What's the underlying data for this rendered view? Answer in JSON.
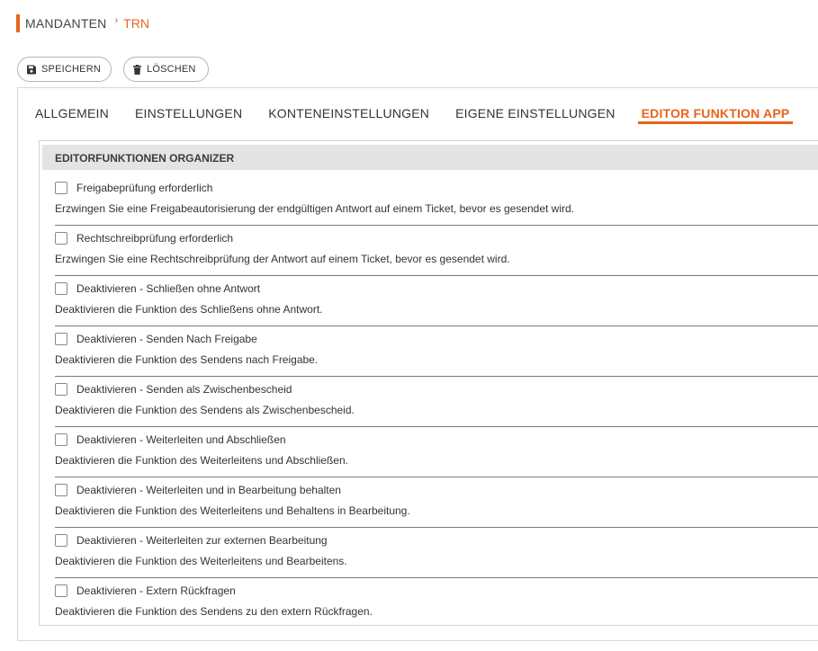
{
  "breadcrumb": {
    "root": "MANDANTEN",
    "separator": "›",
    "current": "TRN"
  },
  "toolbar": {
    "save_label": "SPEICHERN",
    "delete_label": "LÖSCHEN"
  },
  "tabs": [
    {
      "label": "ALLGEMEIN",
      "active": false
    },
    {
      "label": "EINSTELLUNGEN",
      "active": false
    },
    {
      "label": "KONTENEINSTELLUNGEN",
      "active": false
    },
    {
      "label": "EIGENE EINSTELLUNGEN",
      "active": false
    },
    {
      "label": "EDITOR FUNKTION APP",
      "active": true
    }
  ],
  "panel": {
    "title": "EDITORFUNKTIONEN ORGANIZER",
    "options": [
      {
        "label": "Freigabeprüfung erforderlich",
        "checked": false,
        "description": "Erzwingen Sie eine Freigabeautorisierung der endgültigen Antwort auf einem Ticket, bevor es gesendet wird."
      },
      {
        "label": "Rechtschreibprüfung erforderlich",
        "checked": false,
        "description": "Erzwingen Sie eine Rechtschreibprüfung der Antwort auf einem Ticket, bevor es gesendet wird."
      },
      {
        "label": "Deaktivieren - Schließen ohne Antwort",
        "checked": false,
        "description": "Deaktivieren die Funktion des Schließens ohne Antwort."
      },
      {
        "label": "Deaktivieren - Senden Nach Freigabe",
        "checked": false,
        "description": "Deaktivieren die Funktion des Sendens nach Freigabe."
      },
      {
        "label": "Deaktivieren - Senden als Zwischenbescheid",
        "checked": false,
        "description": "Deaktivieren die Funktion des Sendens als Zwischenbescheid."
      },
      {
        "label": "Deaktivieren - Weiterleiten und Abschließen",
        "checked": false,
        "description": "Deaktivieren die Funktion des Weiterleitens und Abschließen."
      },
      {
        "label": "Deaktivieren - Weiterleiten und in Bearbeitung behalten",
        "checked": false,
        "description": "Deaktivieren die Funktion des Weiterleitens und Behaltens in Bearbeitung."
      },
      {
        "label": "Deaktivieren - Weiterleiten zur externen Bearbeitung",
        "checked": false,
        "description": "Deaktivieren die Funktion des Weiterleitens und Bearbeitens."
      },
      {
        "label": "Deaktivieren - Extern Rückfragen",
        "checked": false,
        "description": "Deaktivieren die Funktion des Sendens zu den extern Rückfragen."
      }
    ]
  },
  "colors": {
    "accent": "#e8641b",
    "header_bg": "#e4e4e4",
    "divider": "#7a7a7a"
  },
  "icons": {
    "save": "floppy-disk-icon",
    "delete": "trash-icon"
  }
}
